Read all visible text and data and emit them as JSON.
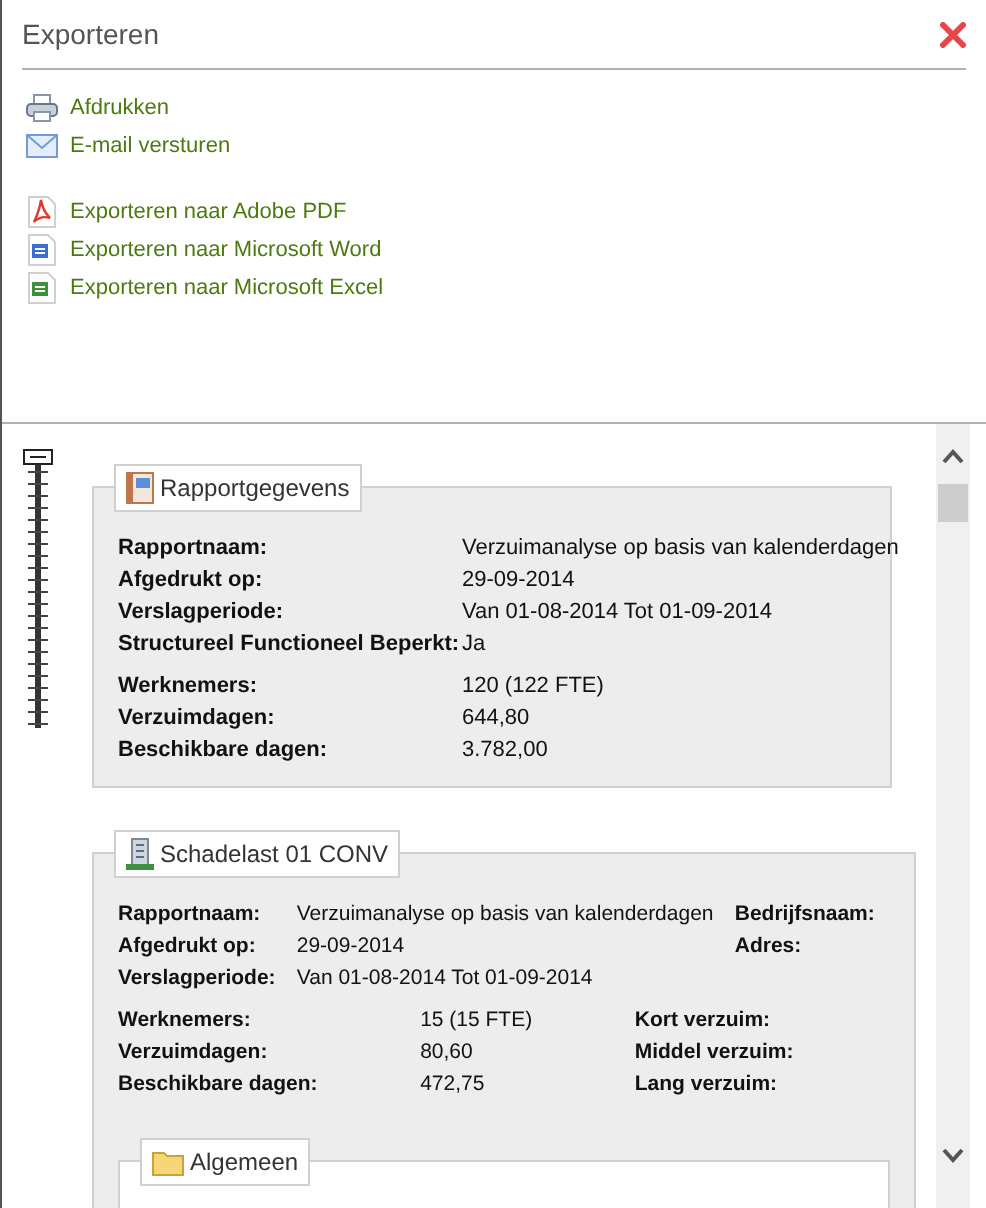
{
  "window": {
    "title": "Exporteren"
  },
  "zoom_slider": {
    "level": 1
  },
  "action_groups": [
    [
      {
        "label": "Afdrukken",
        "kind": "print"
      },
      {
        "label": "E-mail versturen",
        "kind": "email"
      }
    ],
    [
      {
        "label": "Exporteren naar Adobe PDF",
        "kind": "pdf"
      },
      {
        "label": "Exporteren naar Microsoft Word",
        "kind": "word"
      },
      {
        "label": "Exporteren naar Microsoft Excel",
        "kind": "excel"
      }
    ]
  ],
  "panels": [
    {
      "title": "Rapportgegevens",
      "kind": "report",
      "row_groups": [
        [
          {
            "label": "Rapportnaam:",
            "value": "Verzuimanalyse op basis van kalenderdagen"
          },
          {
            "label": "Afgedrukt op:",
            "value": "29-09-2014"
          },
          {
            "label": "Verslagperiode:",
            "value": "Van 01-08-2014 Tot 01-09-2014"
          },
          {
            "label": "Structureel Functioneel Beperkt:",
            "value": "Ja"
          }
        ],
        [
          {
            "label": "Werknemers:",
            "value": "120 (122 FTE)"
          },
          {
            "label": "Verzuimdagen:",
            "value": "644,80"
          },
          {
            "label": "Beschikbare dagen:",
            "value": "3.782,00"
          }
        ]
      ]
    },
    {
      "title": "Schadelast 01 CONV",
      "kind": "company",
      "row_groups": [
        [
          {
            "label": "Rapportnaam:",
            "value": "Verzuimanalyse op basis van kalenderdagen",
            "right_label": "Bedrijfsnaam:"
          },
          {
            "label": "Afgedrukt op:",
            "value": "29-09-2014",
            "right_label": "Adres:"
          },
          {
            "label": "Verslagperiode:",
            "value": "Van 01-08-2014 Tot 01-09-2014"
          }
        ],
        [
          {
            "label": "Werknemers:",
            "value": "15 (15 FTE)",
            "right_label": "Kort verzuim:"
          },
          {
            "label": "Verzuimdagen:",
            "value": "80,60",
            "right_label": "Middel verzuim:"
          },
          {
            "label": "Beschikbare dagen:",
            "value": "472,75",
            "right_label": "Lang verzuim:"
          }
        ]
      ],
      "subpanel": {
        "title": "Algemeen"
      }
    }
  ]
}
